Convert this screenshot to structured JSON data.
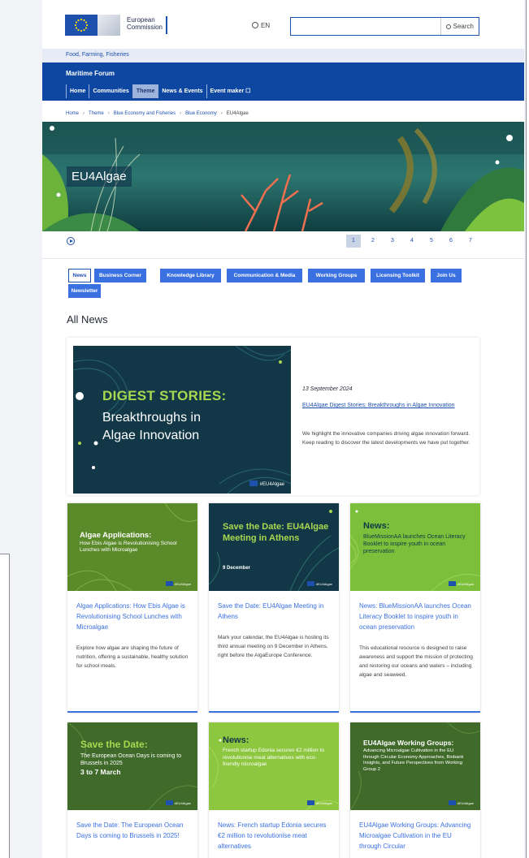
{
  "header": {
    "logo_line1": "European",
    "logo_line2": "Commission",
    "language": "EN",
    "search_label": "Search"
  },
  "site_crumb": "Food, Farming, Fisheries",
  "nav": {
    "site_title": "Maritime Forum",
    "items": [
      {
        "label": "Home"
      },
      {
        "label": "Communities"
      },
      {
        "label": "Theme"
      },
      {
        "label": "News & Events"
      },
      {
        "label": "Event maker ☐"
      }
    ]
  },
  "breadcrumb": [
    "Home",
    "Theme",
    "Blue Economy and Fisheries",
    "Blue Economy",
    "EU4Algae"
  ],
  "hero": {
    "title": "EU4Algae"
  },
  "pager": {
    "pages": [
      "1",
      "2",
      "3",
      "4",
      "5",
      "6",
      "7"
    ],
    "active": "1"
  },
  "tabs": [
    "News",
    "Business Corner",
    "Knowledge Library",
    "Communication & Media",
    "Working Groups",
    "Licensing Toolkit",
    "Join Us",
    "Newsletter"
  ],
  "section_title": "All News",
  "feature": {
    "img_heading": "DIGEST STORIES:",
    "img_line1": "Breakthroughs in",
    "img_line2": "Algae Innovation",
    "img_tag": "#EU4Algae",
    "date": "13 September 2024",
    "link": "EU4Algae Digest Stories: Breakthroughs in Algae Innovation",
    "desc": "We highlight the innovative companies driving algae innovation forward. Keep reading to discover the latest developments we have put together."
  },
  "cards": [
    {
      "img_heading": "Algae Applications:",
      "img_sub": "How Ebis Algae is Revolutionising School Lunches with Microalgae",
      "title": "Algae Applications: How Ebis Algae is Revolutionising School Lunches with Microalgae",
      "desc": "Explore how algae are shaping the future of nutrition, offering a sustainable, healthy solution for school meals.",
      "color": "#5a8a2a"
    },
    {
      "img_heading": "Save the Date: EU4Algae Meeting in Athens",
      "img_sub": "9 December",
      "title": "Save the Date: EU4Algae Meeting in Athens",
      "desc": "Mark your calendar, the EU4Algae is hosting its third annual meeting on 9 December in Athens, right before the AlgaEurope Conference.",
      "color": "#123847"
    },
    {
      "img_heading": "News:",
      "img_sub": "BlueMissionAA launches Ocean Literacy Booklet to inspire youth in ocean preservation",
      "title": "News: BlueMissionAA launches Ocean Literacy Booklet to inspire youth in ocean preservation",
      "desc": "This educational resource is designed to raise awareness and support the mission of protecting and restoring our oceans and waters – including algae and seaweed.",
      "color": "#7cbf3a"
    },
    {
      "img_heading": "Save the Date:",
      "img_sub": "The European Ocean Days is coming to Brussels in 2025",
      "img_sub2": "3 to 7 March",
      "title": "Save the Date: The European Ocean Days is coming to Brussels in 2025!",
      "color": "#3f6a2a"
    },
    {
      "img_heading": "News:",
      "img_sub": "French startup Edonia secures €2 million to revolutionise meat alternatives with eco-friendly microalgae",
      "title": "News: French startup Edonia secures €2 million to revolutionise meat alternatives",
      "color": "#8dc63f"
    },
    {
      "img_heading": "EU4Algae Working Groups:",
      "img_sub": "Advancing Microalgae Cultivation in the EU through Circular Economy Approaches, Biobank Insights, and Future Perspectives from Working Group 2",
      "title": "EU4Algae Working Groups: Advancing Microalgae Cultivation in the EU through Circular",
      "color": "#3f6a2a"
    }
  ],
  "card_tag": "#EU4Algae"
}
